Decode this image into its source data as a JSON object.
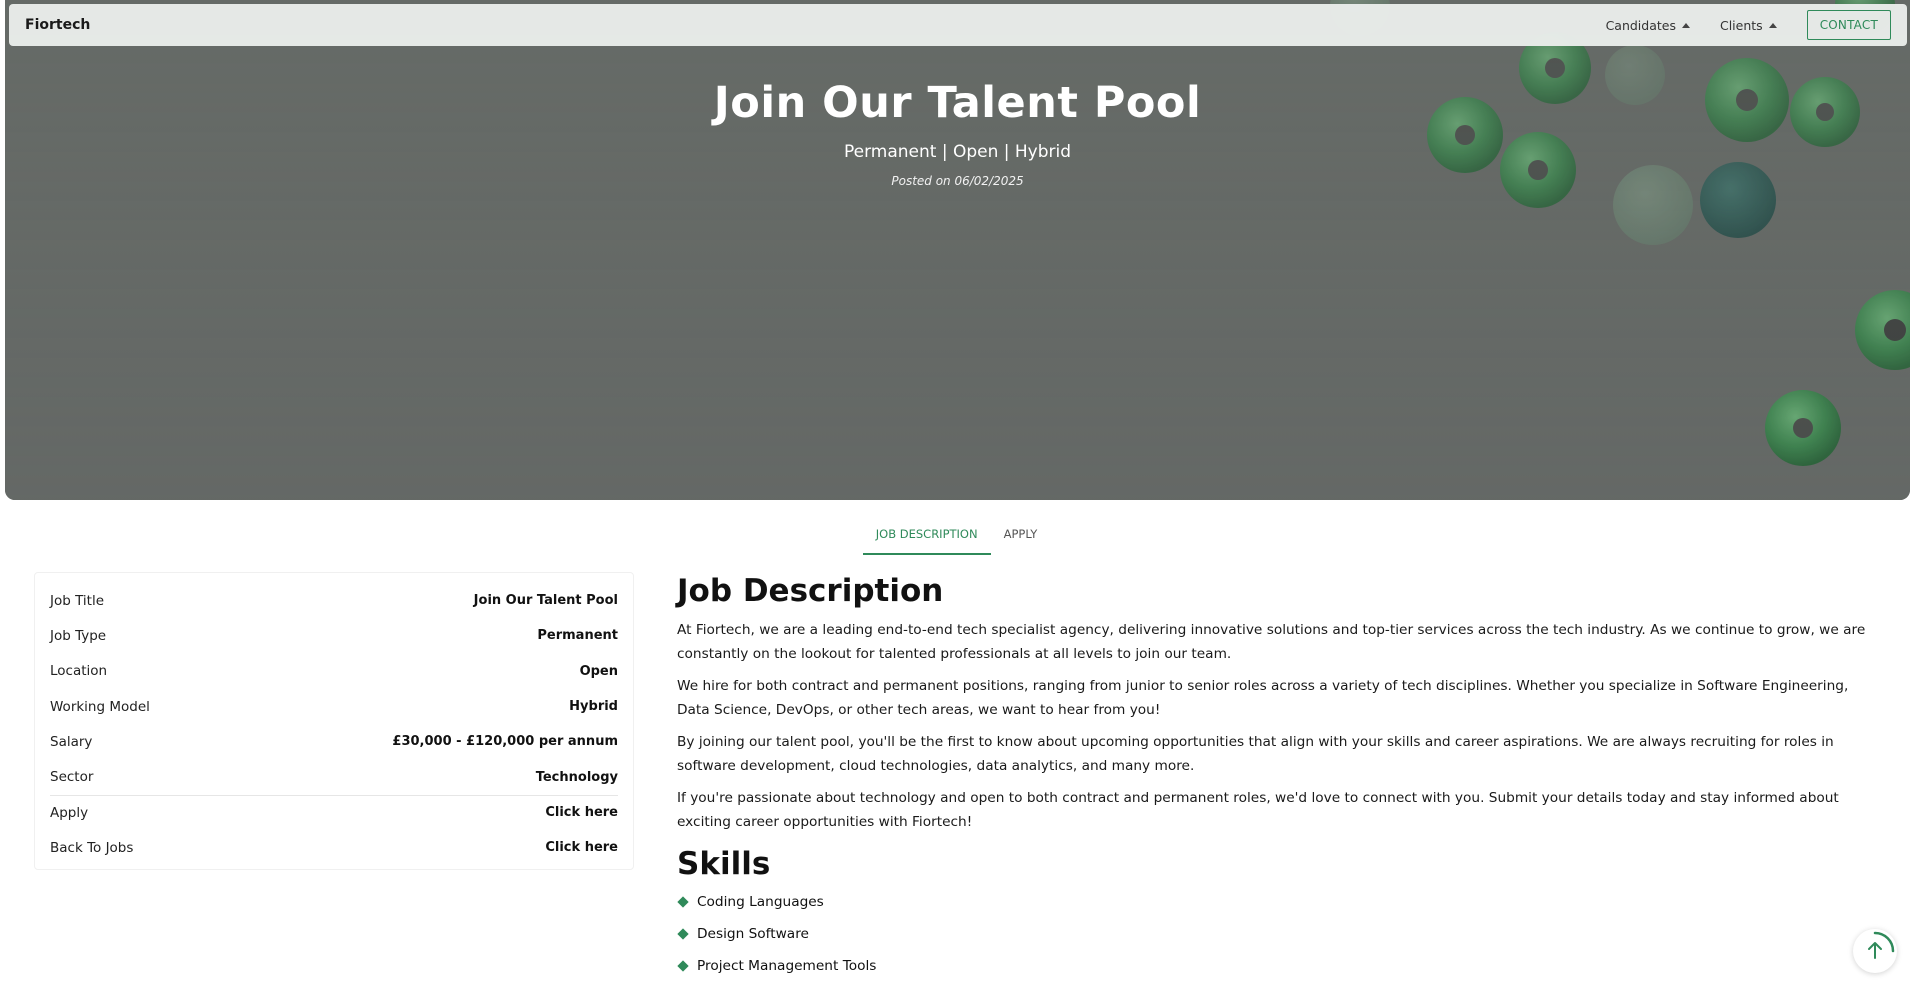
{
  "navbar": {
    "brand": "Fiortech",
    "menus": [
      {
        "label": "Candidates",
        "icon": "caret-up-icon"
      },
      {
        "label": "Clients",
        "icon": "caret-up-icon"
      }
    ],
    "contact_label": "CONTACT"
  },
  "hero": {
    "title": "Join Our Talent Pool",
    "subtitle": "Permanent | Open | Hybrid",
    "posted": "Posted on 06/02/2025"
  },
  "tabs": [
    {
      "label": "JOB DESCRIPTION",
      "active": true
    },
    {
      "label": "APPLY",
      "active": false
    }
  ],
  "details": [
    {
      "label": "Job Title",
      "value": "Join Our Talent Pool"
    },
    {
      "label": "Job Type",
      "value": "Permanent"
    },
    {
      "label": "Location",
      "value": "Open"
    },
    {
      "label": "Working Model",
      "value": "Hybrid"
    },
    {
      "label": "Salary",
      "value": "£30,000 - £120,000 per annum"
    },
    {
      "label": "Sector",
      "value": "Technology"
    },
    {
      "label": "Apply",
      "value": "Click here"
    },
    {
      "label": "Back To Jobs",
      "value": "Click here"
    }
  ],
  "description": {
    "heading": "Job Description",
    "paragraphs": [
      "At Fiortech, we are a leading end-to-end tech specialist agency, delivering innovative solutions and top-tier services across the tech industry. As we continue to grow, we are constantly on the lookout for talented professionals at all levels to join our team.",
      "We hire for both contract and permanent positions, ranging from junior to senior roles across a variety of tech disciplines. Whether you specialize in Software Engineering, Data Science, DevOps, or other tech areas, we want to hear from you!",
      "By joining our talent pool, you'll be the first to know about upcoming opportunities that align with your skills and career aspirations. We are always recruiting for roles in software development, cloud technologies, data analytics, and many more.",
      "If you're passionate about technology and open to both contract and permanent roles, we'd love to connect with you. Submit your details today and stay informed about exciting career opportunities with Fiortech!"
    ]
  },
  "skills": {
    "heading": "Skills",
    "items": [
      "Coding Languages",
      "Design Software",
      "Project Management Tools"
    ]
  },
  "colors": {
    "accent": "#2f8a5a",
    "hero_bg": "#6b6f6c",
    "sequin_green": "#3f9a55"
  },
  "scroll_top_icon": "arrow-up-icon"
}
